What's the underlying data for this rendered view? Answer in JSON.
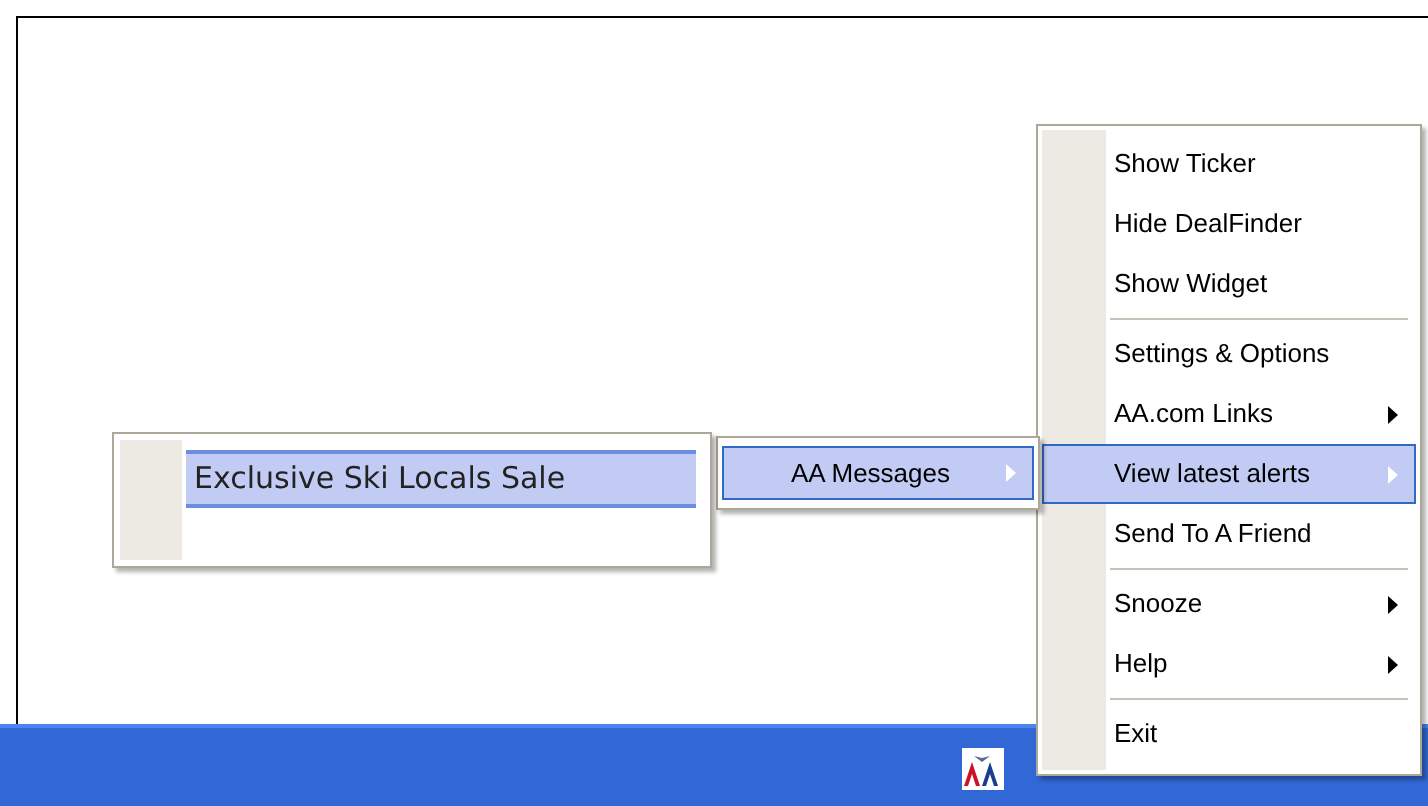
{
  "context_menu": {
    "items": [
      {
        "kind": "item",
        "label": "Show Ticker",
        "has_submenu": false,
        "selected": false
      },
      {
        "kind": "item",
        "label": "Hide DealFinder",
        "has_submenu": false,
        "selected": false
      },
      {
        "kind": "item",
        "label": "Show Widget",
        "has_submenu": false,
        "selected": false
      },
      {
        "kind": "separator"
      },
      {
        "kind": "item",
        "label": "Settings & Options",
        "has_submenu": false,
        "selected": false
      },
      {
        "kind": "item",
        "label": "AA.com Links",
        "has_submenu": true,
        "selected": false
      },
      {
        "kind": "item",
        "label": "View latest alerts",
        "has_submenu": true,
        "selected": true
      },
      {
        "kind": "item",
        "label": "Send To A Friend",
        "has_submenu": false,
        "selected": false
      },
      {
        "kind": "separator"
      },
      {
        "kind": "item",
        "label": "Snooze",
        "has_submenu": true,
        "selected": false
      },
      {
        "kind": "item",
        "label": "Help",
        "has_submenu": true,
        "selected": false
      },
      {
        "kind": "separator"
      },
      {
        "kind": "item",
        "label": "Exit",
        "has_submenu": false,
        "selected": false
      }
    ]
  },
  "alerts_submenu": {
    "items": [
      {
        "kind": "item",
        "label": "AA Messages",
        "has_submenu": true,
        "selected": true
      }
    ]
  },
  "messages_submenu": {
    "items": [
      {
        "kind": "item",
        "label": "Exclusive Ski Locals Sale",
        "has_submenu": false,
        "selected": true
      }
    ]
  }
}
